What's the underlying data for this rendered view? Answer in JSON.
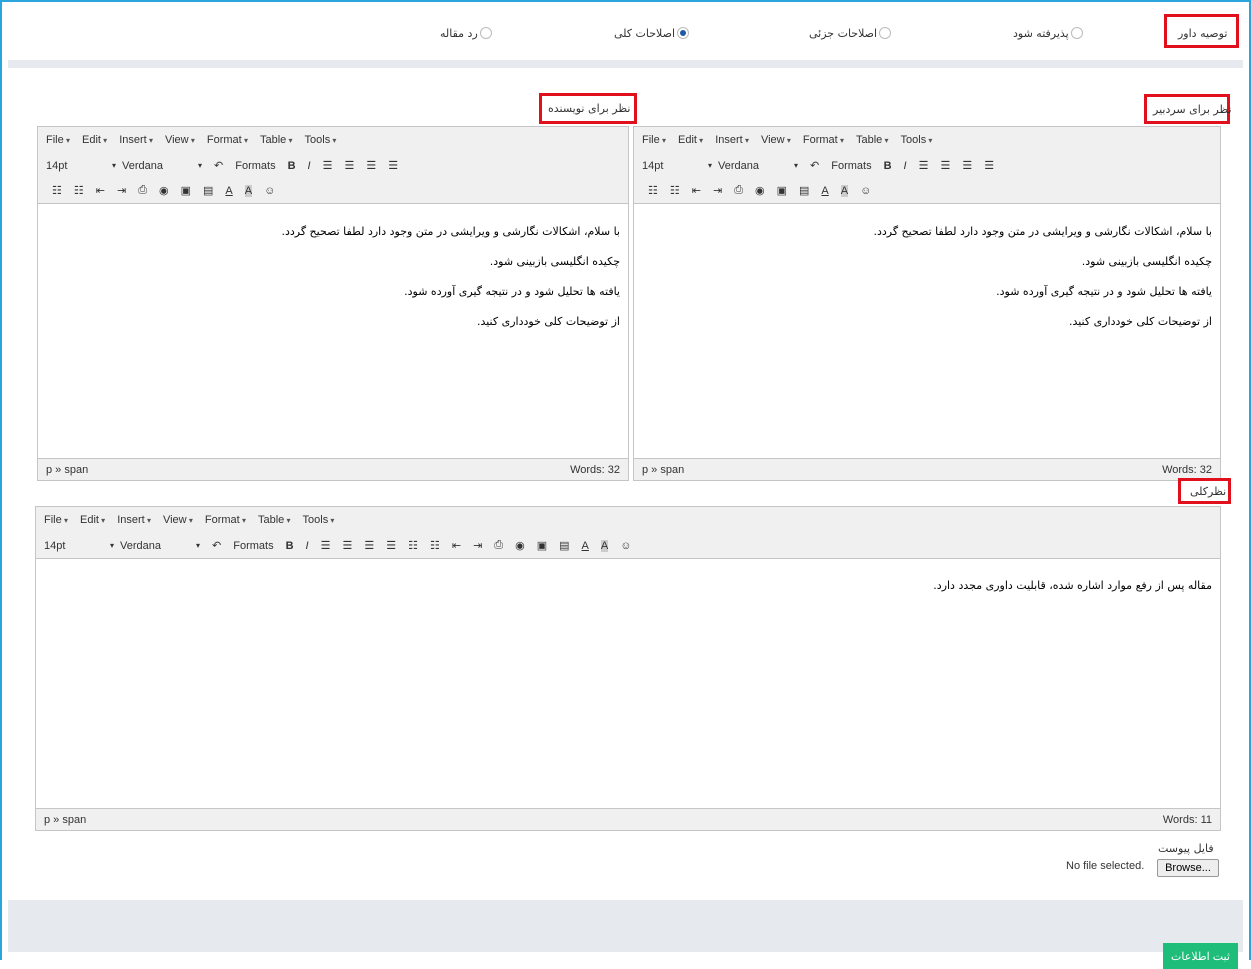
{
  "reviewer_recommendation": {
    "label": "توصیه داور",
    "options": [
      {
        "label": "پذیرفته شود",
        "checked": false
      },
      {
        "label": "اصلاحات جزئی",
        "checked": false
      },
      {
        "label": "اصلاحات کلی",
        "checked": true
      },
      {
        "label": "رد مقاله",
        "checked": false
      }
    ]
  },
  "editor_labels": {
    "for_editor": "نظر برای سردبیر",
    "for_author": "نظر برای نویسنده",
    "general": "نظرکلی"
  },
  "menu": [
    "File",
    "Edit",
    "Insert",
    "View",
    "Format",
    "Table",
    "Tools"
  ],
  "toolbar": {
    "font_size": "14pt",
    "font_family": "Verdana",
    "formats": "Formats",
    "bold": "B",
    "italic": "I"
  },
  "author_comment_lines": [
    "با سلام، اشکالات نگارشی و ویرایشی در متن وجود دارد لطفا تصحیح گردد.",
    "چکیده انگلیسی بازبینی شود.",
    "یافته ها تحلیل شود و در نتیجه گیری آورده شود.",
    "از توضیحات کلی خودداری کنید."
  ],
  "editor_comment_lines": [
    "با سلام، اشکالات نگارشی و ویرایشی در متن وجود دارد لطفا تصحیح گردد.",
    "چکیده انگلیسی بازبینی شود.",
    "یافته ها تحلیل شود و در نتیجه گیری آورده شود.",
    "از توضیحات کلی خودداری کنید."
  ],
  "general_comment": "مقاله پس از رفع موارد اشاره شده، قابلیت داوری مجدد دارد.",
  "status": {
    "path": "p » span",
    "words_top": "Words: 32",
    "words_general": "Words: 11"
  },
  "attachment": {
    "label": "فایل پیوست",
    "browse": "Browse...",
    "no_file": "No file selected."
  },
  "submit": "ثبت اطلاعات",
  "colors": {
    "accent_border": "#2aa6dc",
    "highlight": "#e0101c",
    "submit": "#1ebd7a"
  }
}
